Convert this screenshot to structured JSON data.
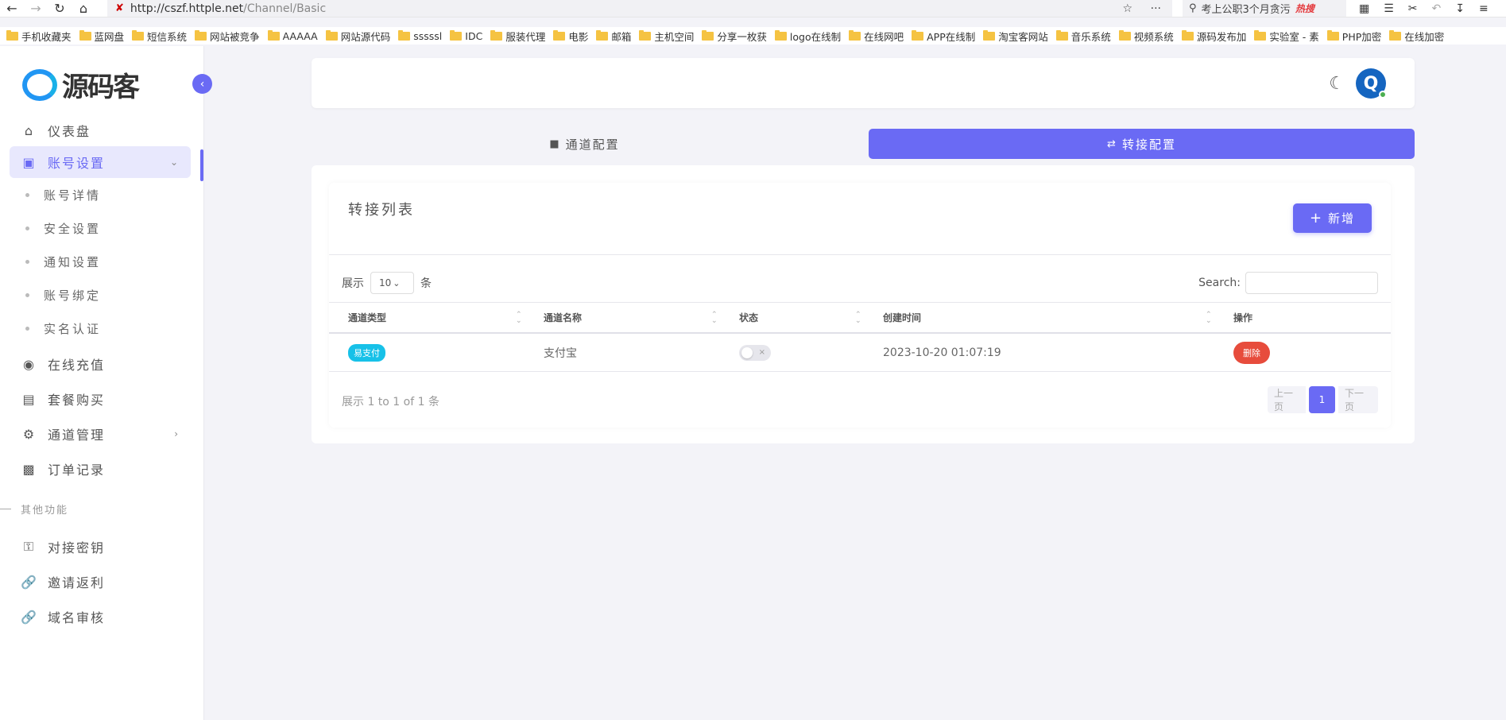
{
  "browser": {
    "url_host": "http://cszf.httple.net",
    "url_path": "/Channel/Basic",
    "search_text": "考上公职3个月贪污",
    "search_hot": "热搜",
    "bookmarks": [
      "手机收藏夹",
      "蓝网盘",
      "短信系统",
      "网站被竞争",
      "AAAAA",
      "网站源代码",
      "sssssl",
      "IDC",
      "服装代理",
      "电影",
      "邮箱",
      "主机空间",
      "分享一枚获",
      "logo在线制",
      "在线网吧",
      "APP在线制",
      "淘宝客网站",
      "音乐系统",
      "视频系统",
      "源码发布加",
      "实验室 - 素",
      "PHP加密",
      "在线加密"
    ]
  },
  "sidebar": {
    "logo_text": "源码客",
    "menu": [
      {
        "label": "仪表盘",
        "icon": "home-icon"
      },
      {
        "label": "账号设置",
        "icon": "account-card-icon",
        "active": true
      },
      {
        "label": "在线充值",
        "icon": "cash-icon"
      },
      {
        "label": "套餐购买",
        "icon": "shopping-bag-icon"
      },
      {
        "label": "通道管理",
        "icon": "gear-icon"
      },
      {
        "label": "订单记录",
        "icon": "wallet-icon"
      }
    ],
    "submenu": [
      "账号详情",
      "安全设置",
      "通知设置",
      "账号绑定",
      "实名认证"
    ],
    "section_label": "其他功能",
    "other": [
      {
        "label": "对接密钥",
        "icon": "key-icon"
      },
      {
        "label": "邀请返利",
        "icon": "link-icon"
      },
      {
        "label": "域名审核",
        "icon": "link-icon"
      }
    ]
  },
  "tabs": [
    {
      "label": "通道配置",
      "icon": "chat-icon"
    },
    {
      "label": "转接配置",
      "icon": "swap-icon",
      "active": true
    }
  ],
  "card": {
    "title": "转接列表",
    "add_label": "新增",
    "show_label": "展示",
    "page_size": "10",
    "unit_label": "条",
    "search_label": "Search:",
    "columns": [
      "通道类型",
      "通道名称",
      "状态",
      "创建时间",
      "操作"
    ],
    "rows": [
      {
        "type": "易支付",
        "name": "支付宝",
        "status": "off",
        "created": "2023-10-20 01:07:19",
        "action": "删除"
      }
    ],
    "info": "展示 1 to 1 of 1 条",
    "pager": {
      "prev": "上一页",
      "current": "1",
      "next": "下一页"
    }
  },
  "colors": {
    "accent": "#6a6af4",
    "badge": "#17c1e8",
    "danger": "#e74c3c"
  }
}
